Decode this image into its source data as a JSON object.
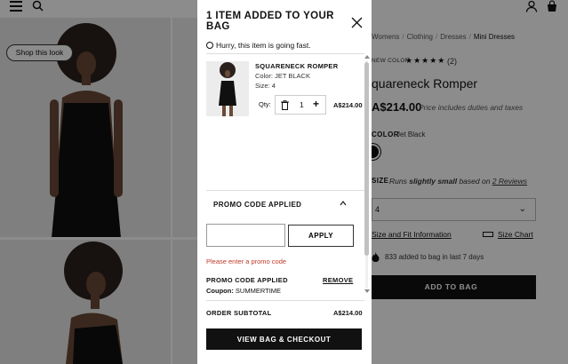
{
  "header": {
    "menu_icon": "hamburger-icon",
    "search_icon": "search-icon",
    "account_icon": "user-icon",
    "bag_icon": "shopping-bag-icon"
  },
  "gallery": {
    "shop_look_label": "Shop this look"
  },
  "product": {
    "breadcrumb": [
      "Womens",
      "Clothing",
      "Dresses",
      "Mini Dresses"
    ],
    "badge": "NEW COLOR",
    "stars": "★★★★★",
    "review_count": "(2)",
    "name": "quareneck Romper",
    "price": "A$214.00",
    "price_note": "Price includes duties and taxes",
    "color_label": "COLOR",
    "color_value": "Jet Black",
    "size_label": "SIZE",
    "size_note_prefix": "Runs",
    "size_note_bold": "slightly small",
    "size_note_mid": "based on",
    "size_note_link": "2 Reviews",
    "size_selected": "4",
    "fit_link": "Size and Fit Information",
    "size_chart_link": "Size Chart",
    "added_note": "833 added to bag in last 7 days",
    "add_to_bag": "ADD TO BAG"
  },
  "modal": {
    "title": "1 ITEM ADDED TO YOUR BAG",
    "hurry": "Hurry, this item is going fast.",
    "item": {
      "name": "SQUARENECK ROMPER",
      "color": "Color: JET BLACK",
      "size": "Size: 4",
      "qty_label": "Qty:",
      "qty": "1",
      "price": "A$214.00"
    },
    "promo": {
      "header": "PROMO CODE APPLIED",
      "input_value": "",
      "apply_label": "APPLY",
      "error": "Please enter a promo code",
      "applied_header": "PROMO CODE APPLIED",
      "remove_label": "REMOVE",
      "coupon_label": "Coupon:",
      "coupon_value": "SUMMERTIME"
    },
    "subtotal_label": "ORDER SUBTOTAL",
    "subtotal_value": "A$214.00",
    "checkout_label": "VIEW BAG & CHECKOUT"
  }
}
